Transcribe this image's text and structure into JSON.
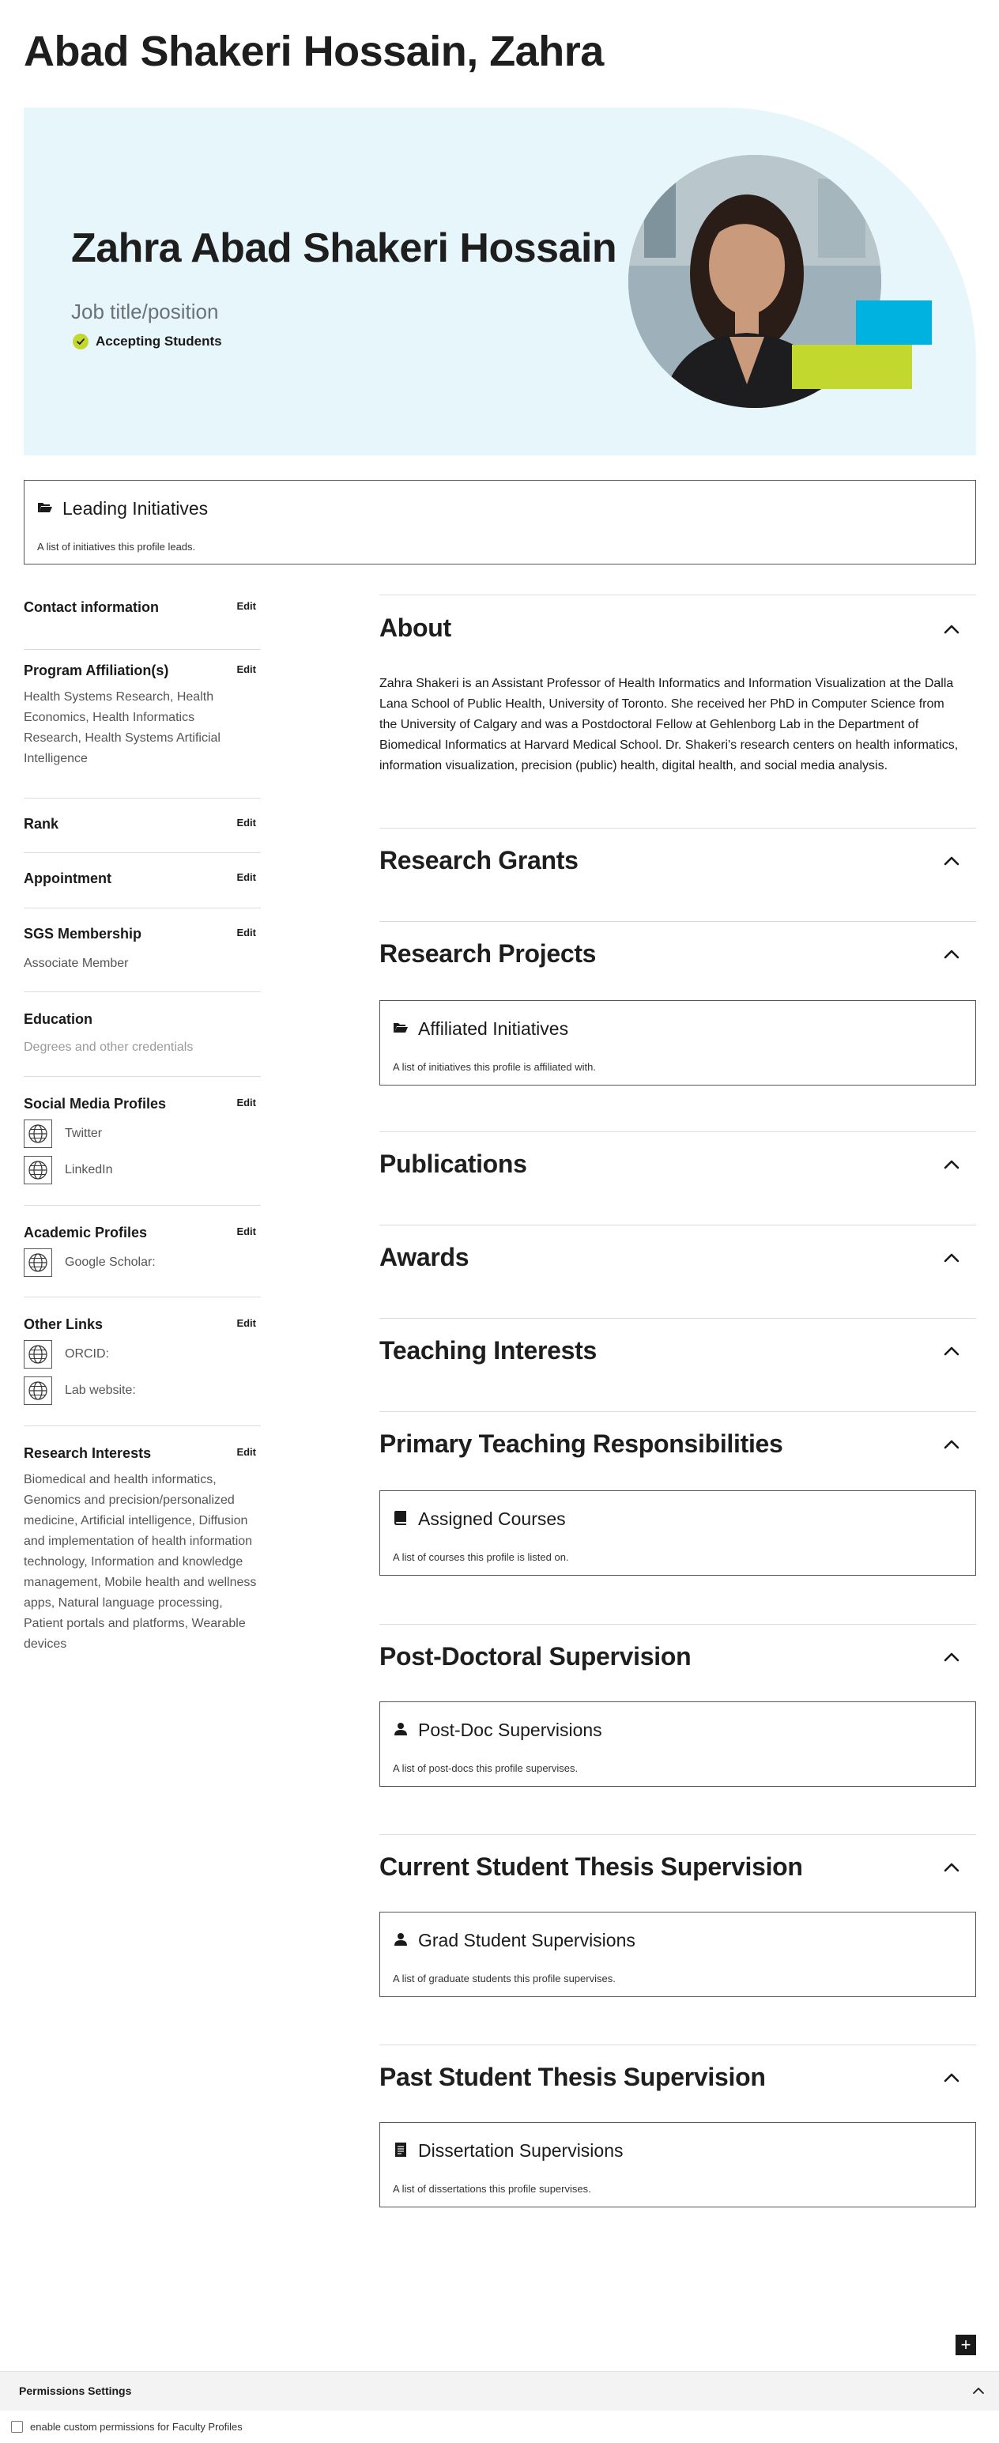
{
  "page": {
    "title": "Abad Shakeri Hossain, Zahra"
  },
  "hero": {
    "name": "Zahra Abad Shakeri Hossain",
    "job_title": "Job title/position",
    "badge": "Accepting Students",
    "colors": {
      "background": "#e6f6fb",
      "accent_blue": "#00b2df",
      "accent_green": "#c2d82f"
    }
  },
  "leading": {
    "title": "Leading Initiatives",
    "description": "A list of initiatives this profile leads.",
    "icon": "folder-open-icon"
  },
  "sidebar": {
    "edit_label": "Edit",
    "contact": {
      "heading": "Contact information"
    },
    "program": {
      "heading": "Program Affiliation(s)",
      "text": "Health Systems Research, Health Economics, Health Informatics Research, Health Systems Artificial Intelligence"
    },
    "rank": {
      "heading": "Rank"
    },
    "appointment": {
      "heading": "Appointment"
    },
    "sgs": {
      "heading": "SGS Membership",
      "text": "Associate Member"
    },
    "education": {
      "heading": "Education",
      "text": "Degrees and other credentials"
    },
    "social": {
      "heading": "Social Media Profiles",
      "links": [
        "Twitter",
        "LinkedIn"
      ]
    },
    "academic": {
      "heading": "Academic Profiles",
      "links": [
        "Google Scholar:"
      ]
    },
    "other": {
      "heading": "Other Links",
      "links": [
        "ORCID:",
        "Lab website:"
      ]
    },
    "research": {
      "heading": "Research Interests",
      "text": "Biomedical and health informatics, Genomics and precision/personalized medicine, Artificial intelligence, Diffusion and implementation of health information technology, Information and knowledge management, Mobile health and wellness apps, Natural language processing, Patient portals and platforms, Wearable devices"
    }
  },
  "sections": {
    "about": {
      "title": "About",
      "text": "Zahra Shakeri is an Assistant Professor of Health Informatics and Information Visualization at the Dalla Lana School of Public Health, University of Toronto. She received her PhD in Computer Science from the University of Calgary and was a Postdoctoral Fellow at Gehlenborg Lab in the Department of Biomedical Informatics at Harvard Medical School. Dr. Shakeri's research centers on health informatics, information visualization, precision (public) health, digital health, and social media analysis."
    },
    "grants": {
      "title": "Research Grants"
    },
    "projects": {
      "title": "Research Projects",
      "card_title": "Affiliated Initiatives",
      "card_desc": "A list of initiatives this profile is affiliated with."
    },
    "publications": {
      "title": "Publications"
    },
    "awards": {
      "title": "Awards"
    },
    "teaching": {
      "title": "Teaching Interests"
    },
    "primary": {
      "title": "Primary Teaching Responsibilities",
      "card_title": "Assigned Courses",
      "card_desc": "A list of courses this profile is listed on."
    },
    "postdoc": {
      "title": "Post-Doctoral Supervision",
      "card_title": "Post-Doc Supervisions",
      "card_desc": "A list of post-docs this profile supervises."
    },
    "current": {
      "title": "Current Student Thesis Supervision",
      "card_title": "Grad Student Supervisions",
      "card_desc": "A list of graduate students this profile supervises."
    },
    "past": {
      "title": "Past Student Thesis Supervision",
      "card_title": "Dissertation Supervisions",
      "card_desc": "A list of dissertations this profile supervises."
    }
  },
  "footer": {
    "add_icon": "plus-icon",
    "permissions_title": "Permissions Settings",
    "permissions_checkbox": "enable custom permissions for Faculty Profiles"
  }
}
